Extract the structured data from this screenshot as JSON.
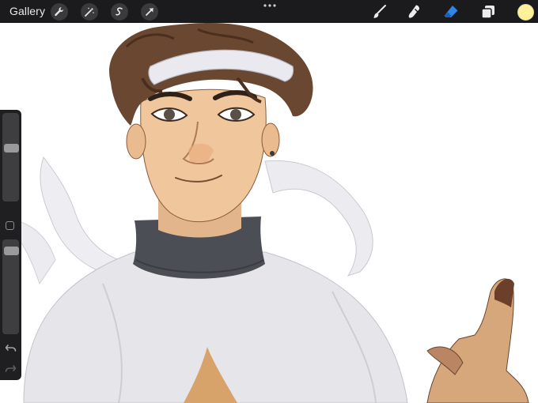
{
  "toolbar": {
    "gallery_label": "Gallery",
    "left_tools": [
      "wrench-icon",
      "magic-wand-icon",
      "selection-icon",
      "transform-icon"
    ],
    "right_tools": [
      "brush-icon",
      "smudge-icon",
      "eraser-icon",
      "layers-icon"
    ],
    "active_color": "#fff19a"
  },
  "sidebar": {
    "brush_size": 0.62,
    "brush_opacity": 0.93
  },
  "colors": {
    "toolbar_bg": "#1b1b1d",
    "eraser_active": "#2f86e8"
  }
}
